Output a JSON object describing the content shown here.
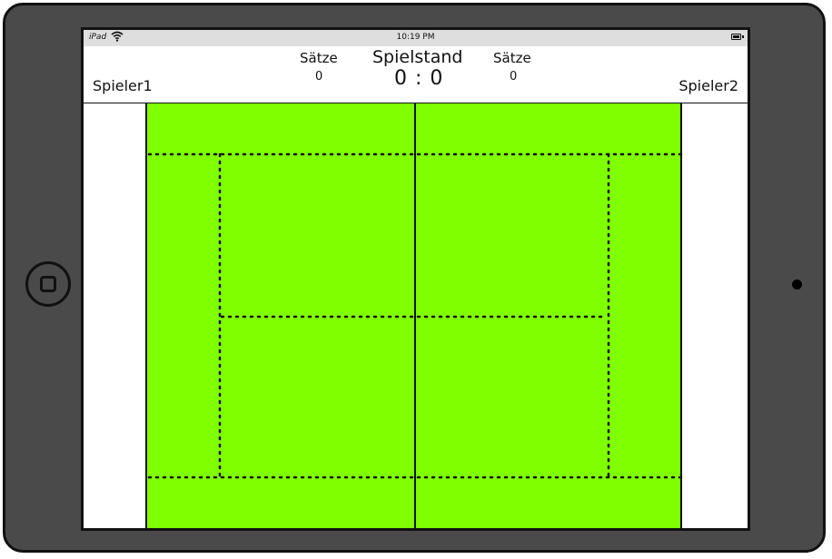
{
  "statusbar": {
    "device": "iPad",
    "time": "10:19 PM",
    "wifi_icon": "wifi-icon",
    "battery_icon": "battery-icon"
  },
  "header": {
    "player1": "Spieler1",
    "player2": "Spieler2",
    "sets_left_label": "Sätze",
    "sets_left_value": "0",
    "sets_right_label": "Sätze",
    "sets_right_value": "0",
    "score_title": "Spielstand",
    "score": "0 : 0"
  },
  "court": {
    "color": "#80ff00",
    "line_color": "#111111"
  },
  "device": {
    "frame_color": "#4a4a4a",
    "home_icon": "home-button-icon",
    "camera_icon": "camera-icon"
  }
}
